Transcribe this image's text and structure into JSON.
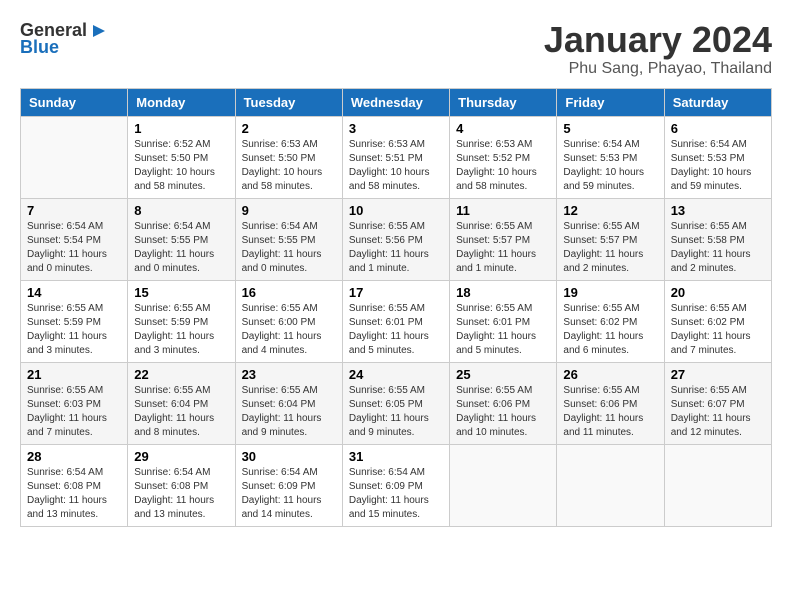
{
  "logo": {
    "line1": "General",
    "line2": "Blue"
  },
  "title": "January 2024",
  "subtitle": "Phu Sang, Phayao, Thailand",
  "headers": [
    "Sunday",
    "Monday",
    "Tuesday",
    "Wednesday",
    "Thursday",
    "Friday",
    "Saturday"
  ],
  "weeks": [
    [
      {
        "day": "",
        "info": ""
      },
      {
        "day": "1",
        "info": "Sunrise: 6:52 AM\nSunset: 5:50 PM\nDaylight: 10 hours\nand 58 minutes."
      },
      {
        "day": "2",
        "info": "Sunrise: 6:53 AM\nSunset: 5:50 PM\nDaylight: 10 hours\nand 58 minutes."
      },
      {
        "day": "3",
        "info": "Sunrise: 6:53 AM\nSunset: 5:51 PM\nDaylight: 10 hours\nand 58 minutes."
      },
      {
        "day": "4",
        "info": "Sunrise: 6:53 AM\nSunset: 5:52 PM\nDaylight: 10 hours\nand 58 minutes."
      },
      {
        "day": "5",
        "info": "Sunrise: 6:54 AM\nSunset: 5:53 PM\nDaylight: 10 hours\nand 59 minutes."
      },
      {
        "day": "6",
        "info": "Sunrise: 6:54 AM\nSunset: 5:53 PM\nDaylight: 10 hours\nand 59 minutes."
      }
    ],
    [
      {
        "day": "7",
        "info": "Sunrise: 6:54 AM\nSunset: 5:54 PM\nDaylight: 11 hours\nand 0 minutes."
      },
      {
        "day": "8",
        "info": "Sunrise: 6:54 AM\nSunset: 5:55 PM\nDaylight: 11 hours\nand 0 minutes."
      },
      {
        "day": "9",
        "info": "Sunrise: 6:54 AM\nSunset: 5:55 PM\nDaylight: 11 hours\nand 0 minutes."
      },
      {
        "day": "10",
        "info": "Sunrise: 6:55 AM\nSunset: 5:56 PM\nDaylight: 11 hours\nand 1 minute."
      },
      {
        "day": "11",
        "info": "Sunrise: 6:55 AM\nSunset: 5:57 PM\nDaylight: 11 hours\nand 1 minute."
      },
      {
        "day": "12",
        "info": "Sunrise: 6:55 AM\nSunset: 5:57 PM\nDaylight: 11 hours\nand 2 minutes."
      },
      {
        "day": "13",
        "info": "Sunrise: 6:55 AM\nSunset: 5:58 PM\nDaylight: 11 hours\nand 2 minutes."
      }
    ],
    [
      {
        "day": "14",
        "info": "Sunrise: 6:55 AM\nSunset: 5:59 PM\nDaylight: 11 hours\nand 3 minutes."
      },
      {
        "day": "15",
        "info": "Sunrise: 6:55 AM\nSunset: 5:59 PM\nDaylight: 11 hours\nand 3 minutes."
      },
      {
        "day": "16",
        "info": "Sunrise: 6:55 AM\nSunset: 6:00 PM\nDaylight: 11 hours\nand 4 minutes."
      },
      {
        "day": "17",
        "info": "Sunrise: 6:55 AM\nSunset: 6:01 PM\nDaylight: 11 hours\nand 5 minutes."
      },
      {
        "day": "18",
        "info": "Sunrise: 6:55 AM\nSunset: 6:01 PM\nDaylight: 11 hours\nand 5 minutes."
      },
      {
        "day": "19",
        "info": "Sunrise: 6:55 AM\nSunset: 6:02 PM\nDaylight: 11 hours\nand 6 minutes."
      },
      {
        "day": "20",
        "info": "Sunrise: 6:55 AM\nSunset: 6:02 PM\nDaylight: 11 hours\nand 7 minutes."
      }
    ],
    [
      {
        "day": "21",
        "info": "Sunrise: 6:55 AM\nSunset: 6:03 PM\nDaylight: 11 hours\nand 7 minutes."
      },
      {
        "day": "22",
        "info": "Sunrise: 6:55 AM\nSunset: 6:04 PM\nDaylight: 11 hours\nand 8 minutes."
      },
      {
        "day": "23",
        "info": "Sunrise: 6:55 AM\nSunset: 6:04 PM\nDaylight: 11 hours\nand 9 minutes."
      },
      {
        "day": "24",
        "info": "Sunrise: 6:55 AM\nSunset: 6:05 PM\nDaylight: 11 hours\nand 9 minutes."
      },
      {
        "day": "25",
        "info": "Sunrise: 6:55 AM\nSunset: 6:06 PM\nDaylight: 11 hours\nand 10 minutes."
      },
      {
        "day": "26",
        "info": "Sunrise: 6:55 AM\nSunset: 6:06 PM\nDaylight: 11 hours\nand 11 minutes."
      },
      {
        "day": "27",
        "info": "Sunrise: 6:55 AM\nSunset: 6:07 PM\nDaylight: 11 hours\nand 12 minutes."
      }
    ],
    [
      {
        "day": "28",
        "info": "Sunrise: 6:54 AM\nSunset: 6:08 PM\nDaylight: 11 hours\nand 13 minutes."
      },
      {
        "day": "29",
        "info": "Sunrise: 6:54 AM\nSunset: 6:08 PM\nDaylight: 11 hours\nand 13 minutes."
      },
      {
        "day": "30",
        "info": "Sunrise: 6:54 AM\nSunset: 6:09 PM\nDaylight: 11 hours\nand 14 minutes."
      },
      {
        "day": "31",
        "info": "Sunrise: 6:54 AM\nSunset: 6:09 PM\nDaylight: 11 hours\nand 15 minutes."
      },
      {
        "day": "",
        "info": ""
      },
      {
        "day": "",
        "info": ""
      },
      {
        "day": "",
        "info": ""
      }
    ]
  ]
}
